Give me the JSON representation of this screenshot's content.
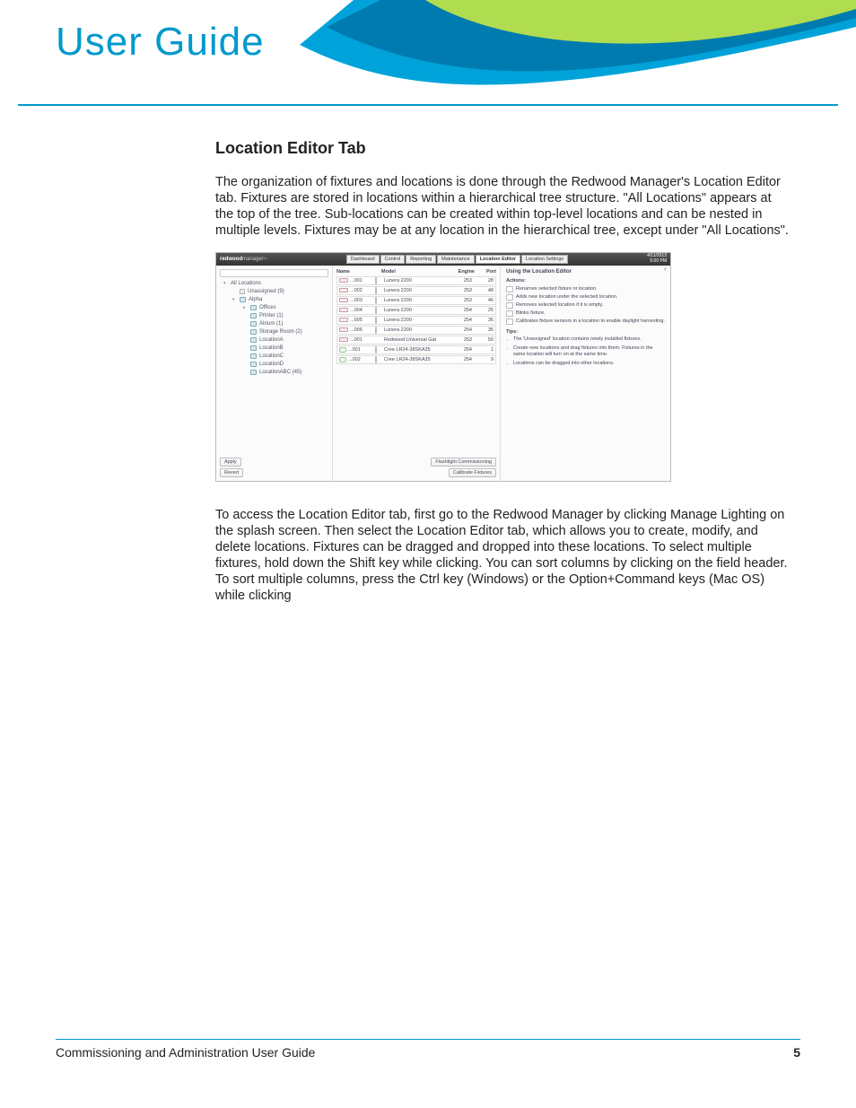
{
  "header": {
    "title": "User Guide"
  },
  "section": {
    "title": "Location Editor Tab",
    "para1": "The organization of fixtures and locations is done through the Redwood Manager's Location Editor tab. Fixtures are stored in locations within a hierarchical tree structure. \"All Locations\" appears at the top of the tree. Sub-locations can be created within top-level locations and can be nested in multiple levels. Fixtures may be at any location in the hierarchical tree, except under \"All Locations\".",
    "para2": "To access the Location Editor tab, first go to the Redwood Manager by clicking Manage Lighting on the splash screen. Then select the Location Editor tab, which allows you to create, modify, and delete locations. Fixtures can be dragged and dropped into these locations. To select multiple fixtures, hold down the Shift key while clicking. You can sort columns by clicking on the field header. To sort multiple columns, press the Ctrl key (Windows) or the Option+Command keys (Mac OS) while clicking"
  },
  "screenshot": {
    "brand1": "redwood",
    "brand2": "manager",
    "tm": "™",
    "tabs": [
      "Dashboard",
      "Control",
      "Reporting",
      "Maintenance",
      "Location Editor",
      "Location Settings"
    ],
    "active_tab": "Location Editor",
    "datetime": {
      "d": "4/11/2013",
      "t": "5:00 PM"
    },
    "tree": [
      {
        "label": "All Locations",
        "indent": 0,
        "tri": "▾"
      },
      {
        "label": "Unassigned (9)",
        "indent": 1,
        "q": true
      },
      {
        "label": "Alpha",
        "indent": 1,
        "tri": "▾",
        "folder": true
      },
      {
        "label": "Offices",
        "indent": 2,
        "tri": "▸",
        "folder": true
      },
      {
        "label": "Printer (1)",
        "indent": 2,
        "folder": true
      },
      {
        "label": "Atrium (1)",
        "indent": 2,
        "folder": true
      },
      {
        "label": "Storage Room (2)",
        "indent": 2,
        "folder": true
      },
      {
        "label": "LocationA",
        "indent": 2,
        "folder": true
      },
      {
        "label": "LocationB",
        "indent": 2,
        "folder": true
      },
      {
        "label": "LocationC",
        "indent": 2,
        "folder": true
      },
      {
        "label": "LocationD",
        "indent": 2,
        "folder": true
      },
      {
        "label": "LocationABC (45)",
        "indent": 2,
        "folder": true
      }
    ],
    "left_buttons": {
      "apply": "Apply",
      "revert": "Revert"
    },
    "columns": {
      "name": "Name",
      "model": "Model",
      "engine": "Engine",
      "port": "Port"
    },
    "rows": [
      {
        "name": "...001",
        "model": "Lunera 2200",
        "engine": "253",
        "port": "28",
        "alt": false
      },
      {
        "name": "...002",
        "model": "Lunera 2200",
        "engine": "253",
        "port": "48",
        "alt": false
      },
      {
        "name": "...003",
        "model": "Lunera 2200",
        "engine": "253",
        "port": "46",
        "alt": false
      },
      {
        "name": "...004",
        "model": "Lunera 2200",
        "engine": "254",
        "port": "25",
        "alt": false
      },
      {
        "name": "...005",
        "model": "Lunera 2200",
        "engine": "254",
        "port": "36",
        "alt": false
      },
      {
        "name": "...006",
        "model": "Lunera 2200",
        "engine": "254",
        "port": "35",
        "alt": false
      },
      {
        "name": "...001",
        "model": "Redwood Universal Gat",
        "engine": "253",
        "port": "50",
        "alt": false,
        "noi": true
      },
      {
        "name": "...001",
        "model": "Cree LR24-38SKA35",
        "engine": "254",
        "port": "1",
        "alt": true
      },
      {
        "name": "...002",
        "model": "Cree LR24-38SKA35",
        "engine": "254",
        "port": "9",
        "alt": true
      }
    ],
    "center_buttons": {
      "flash": "Flashlight Commissioning",
      "cal": "Calibrate Fixtures"
    },
    "help": {
      "title": "Using the Location Editor",
      "actions_label": "Actions:",
      "actions": [
        "Renames selected fixture or location.",
        "Adds new location under the selected location.",
        "Removes selected location if it is empty.",
        "Blinks fixture.",
        "Calibrates fixture sensors in a location to enable daylight harvesting."
      ],
      "tips_label": "Tips:",
      "tips": [
        "The 'Unassigned' location contains newly installed fixtures.",
        "Create new locations and drag fixtures into them. Fixtures in the same location will turn on at the same time.",
        "Locations can be dragged into other locations."
      ]
    }
  },
  "footer": {
    "left": "Commissioning and Administration User Guide",
    "page": "5"
  }
}
